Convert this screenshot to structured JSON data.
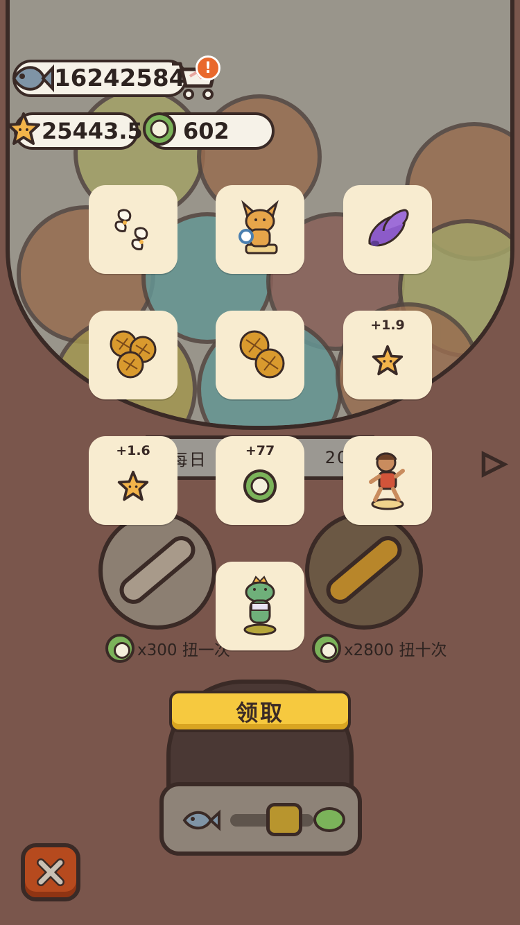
{
  "currencies": {
    "fish": "16242584",
    "stars": "25443.5",
    "coins": "602"
  },
  "alert_badge": "!",
  "machine": {
    "daily_label_left": "每日",
    "daily_label_right": "20",
    "single_cost": "x300 扭一次",
    "ten_cost": "x2800 扭十次"
  },
  "rewards": [
    {
      "name": "flower-petals",
      "amount": ""
    },
    {
      "name": "lynx-figure",
      "amount": ""
    },
    {
      "name": "purple-fish-toy",
      "amount": ""
    },
    {
      "name": "sunflower-cluster",
      "amount": ""
    },
    {
      "name": "sunflower-pair",
      "amount": ""
    },
    {
      "name": "star",
      "amount": "+1.9"
    },
    {
      "name": "star",
      "amount": "+1.6"
    },
    {
      "name": "green-coin",
      "amount": "+77"
    },
    {
      "name": "dancing-boy",
      "amount": ""
    },
    {
      "name": "frog-prince",
      "amount": ""
    }
  ],
  "claim_button": "领取",
  "colors": {
    "background": "#7a564c",
    "tile": "#f8ecd0",
    "claim": "#f6c93f",
    "close": "#b64a1e"
  }
}
